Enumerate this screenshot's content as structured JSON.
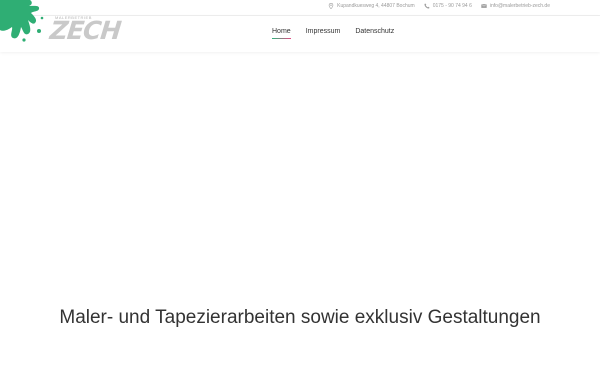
{
  "topbar": {
    "address": "Kupandkuesweg 4, 44807 Bochum",
    "phone": "0175 - 90 74 94 6",
    "email": "info@malerbetrieb-zech.de"
  },
  "logo": {
    "brand": "ZECH",
    "tagline": "MALERBETRIEB",
    "splash_color": "#2fae74"
  },
  "nav": {
    "items": [
      {
        "label": "Home",
        "active": true
      },
      {
        "label": "Impressum",
        "active": false
      },
      {
        "label": "Datenschutz",
        "active": false
      }
    ]
  },
  "hero": {
    "headline": "Maler- und Tapezierarbeiten sowie exklusiv Gestaltungen"
  },
  "icons": {
    "address": "map-pin-icon",
    "phone": "phone-icon",
    "email": "envelope-icon"
  }
}
